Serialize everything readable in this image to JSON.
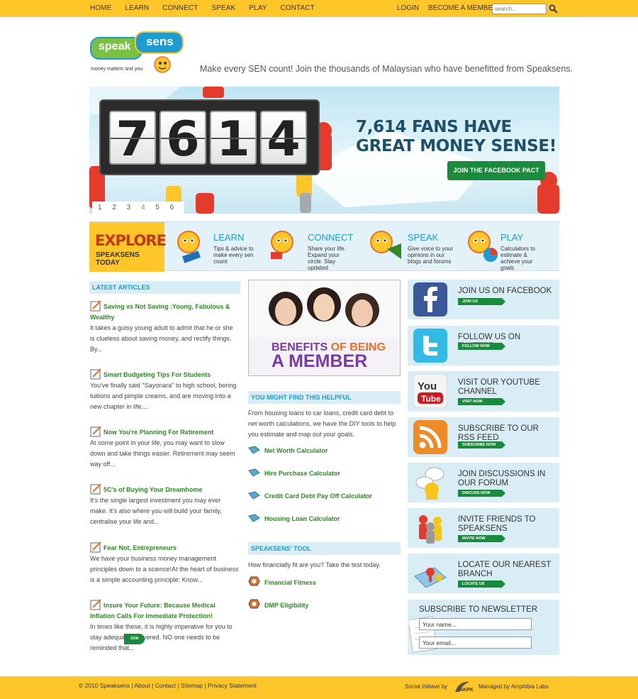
{
  "nav": {
    "items": [
      "HOME",
      "LEARN",
      "CONNECT",
      "SPEAK",
      "PLAY",
      "CONTACT"
    ],
    "login": "LOGIN",
    "become_member": "BECOME A MEMBER",
    "search_placeholder": "search..."
  },
  "logo": {
    "speak": "speak",
    "sens": "sens",
    "sub": "money matters and you"
  },
  "tagline": "Make every SEN count! Join the thousands of Malaysian who have benefitted from Speaksens.",
  "banner": {
    "digits": [
      "7",
      "6",
      "1",
      "4"
    ],
    "headline_1": "7,614 FANS HAVE",
    "headline_2": "GREAT MONEY SENSE!",
    "cta": "JOIN THE FACEBOOK PACT",
    "pages": [
      "1",
      "2",
      "3",
      "4",
      "5",
      "6"
    ],
    "active_page": "4"
  },
  "explore": {
    "title": "EXPLORE",
    "subtitle": "SPEAKSENS TODAY",
    "items": [
      {
        "title": "LEARN",
        "desc": "Tips & advice to make every sen count"
      },
      {
        "title": "CONNECT",
        "desc": "Share your life. Expand your circle. Stay updated"
      },
      {
        "title": "SPEAK",
        "desc": "Give voice to your opinions in our blogs and forums"
      },
      {
        "title": "PLAY",
        "desc": "Calculators to estimate & achieve your goals"
      }
    ]
  },
  "latest": {
    "heading": "LATEST ARTICLES",
    "articles": [
      {
        "title": "Saving vs Not Saving :Young, Fabulous & Wealthy",
        "desc": "It takes a gutsy young adult to admit that he or she is clueless about saving money, and rectify things. By..."
      },
      {
        "title": "Smart Budgeting Tips For Students",
        "desc": "You've finally said \"Sayonara\" to high school, boring tuitions and pimple creams, and are moving into a new chapter in life...."
      },
      {
        "title": "Now You're Planning For Retirement",
        "desc": "At some point in your life, you may want to slow down and take things easier. Retirement may seem way off..."
      },
      {
        "title": "5C's of Buying Your Dreamhome",
        "desc": "It's the single largest investment you may ever make. It's also where you will build your family, centralise your life and..."
      },
      {
        "title": "Fear Not, Entrepreneurs",
        "desc": "We have your business money management principles down to a science!At the heart of business is a simple accounting principle: Know..."
      },
      {
        "title": "Insure Your Future: Because Medical Inflation Calls For Immediate Protection!",
        "desc": "In times like these, it is highly imperative for you to stay adequately covered. NO one needs to be reminded that..."
      }
    ]
  },
  "member": {
    "line1_a": "BENEFITS",
    "line1_b": "OF BEING",
    "line2": "A MEMBER"
  },
  "helpful": {
    "heading": "YOU MIGHT FIND THIS HELPFUL",
    "intro": "From housing loans to car loans, credit card debt to net worth calculations, we have the DIY tools to help you estimate and map out your goals.",
    "calculators": [
      "Net Worth Calculator",
      "Hire Purchase Calculator",
      "Credit Card Debt Pay Off Calculator",
      "Housing Loan Calculator"
    ]
  },
  "tool": {
    "heading": "SPEAKSENS' TOOL",
    "intro": "How financially fit are you? Take the test today.",
    "items": [
      "Financial Fitness",
      "DMP Eligibility"
    ]
  },
  "social": [
    {
      "label": "JOIN US ON FACEBOOK",
      "btn": "JOIN US",
      "color": "#3b5998"
    },
    {
      "label": "FOLLOW US ON TWITTER",
      "btn": "FOLLOW NOW",
      "color": "#33bbe8"
    },
    {
      "label": "VISIT OUR YOUTUBE CHANNEL",
      "btn": "VISIT NOW",
      "color": "#cc181e"
    },
    {
      "label": "SUBSCRIBE TO OUR RSS FEED",
      "btn": "SUBSCRIBE NOW",
      "color": "#f08a24"
    },
    {
      "label": "JOIN DISCUSSIONS IN OUR FORUM",
      "btn": "DISCUSS NOW",
      "color": "#f5c518"
    },
    {
      "label": "INVITE FRIENDS TO SPEAKSENS",
      "btn": "INVITE NOW",
      "color": "#e53b2c"
    },
    {
      "label": "LOCATE OUR NEAREST BRANCH",
      "btn": "LOCATE US",
      "color": "#6aa7d9"
    }
  ],
  "newsletter": {
    "heading": "SUBSCRIBE TO NEWSLETTER",
    "name_value": "Your name...",
    "email_value": "Your email...",
    "join": "JOIN"
  },
  "footer": {
    "copyright": "© 2010 Speaksens",
    "links": [
      "About",
      "Contact",
      "Sitemap",
      "Privacy Statement"
    ],
    "social_initiative": "Social Initiave by",
    "akpk": "AKPK",
    "managed": "Managed by Amphibia Labs"
  }
}
